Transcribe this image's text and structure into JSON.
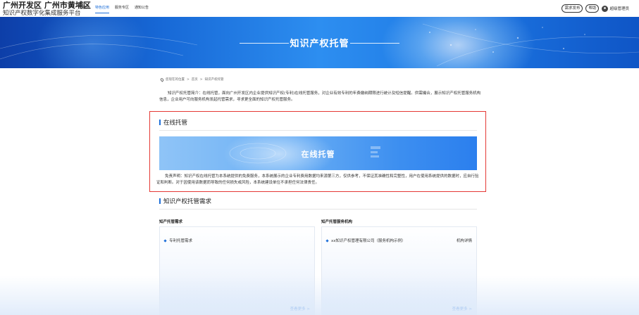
{
  "header": {
    "brand_title": "广州开发区 广州市黄埔区",
    "brand_subtitle": "知识产权数字化集成服务平台",
    "nav": [
      {
        "label": "首页",
        "active": false
      },
      {
        "label": "特色应用",
        "active": true
      },
      {
        "label": "服务专区",
        "active": false
      },
      {
        "label": "通知公告",
        "active": false
      }
    ],
    "btn_demand": "需求发布",
    "btn_help": "帮助",
    "user_name": "超级管理员"
  },
  "banner": {
    "title": "知识产权托管"
  },
  "breadcrumb": {
    "prefix": "您现在的位置",
    "items": [
      "首页",
      "知识产权托管"
    ],
    "separator": ">"
  },
  "intro_text": "知识产权托管简介：在线托管，面向广州开发区内企业提供知识产权(专利)在线托管服务，对企业有效专利的年费缴纳期限进行统计及短信提醒。供需撮合，展示知识产权托管服务机构信息，企业用户可向服务机构发起托管需求，寻求更全面的知识产权托管服务。",
  "online": {
    "section_title": "在线托管",
    "card_title": "在线托管",
    "disclaimer": "免责声明：知识产权在线托管为本系统提供的免费服务，本系统展示的企业专利费用数据均来源第三方，仅供参考，不保证其准确性和完整性，用户在使用系统提供的数据时，应自行验证和判断。对于因使用该数据而导致的任何损失或风险，本系统建设单位不承担任何法律责任。"
  },
  "demand": {
    "section_title": "知识产权托管需求",
    "left": {
      "head": "知产托管需求",
      "items": [
        "专利托管需求"
      ],
      "more": "查看更多 >"
    },
    "right": {
      "head": "知产托管服务机构",
      "items": [
        {
          "name": "xx知识产权管理有限公司（服务机构示例）",
          "detail": "机构详情"
        }
      ],
      "more": "查看更多 >"
    }
  },
  "colors": {
    "accent": "#1e6fd9",
    "highlight_border": "#e53935",
    "banner_dark": "#0d3ea8",
    "banner_light": "#2d8ef0"
  }
}
